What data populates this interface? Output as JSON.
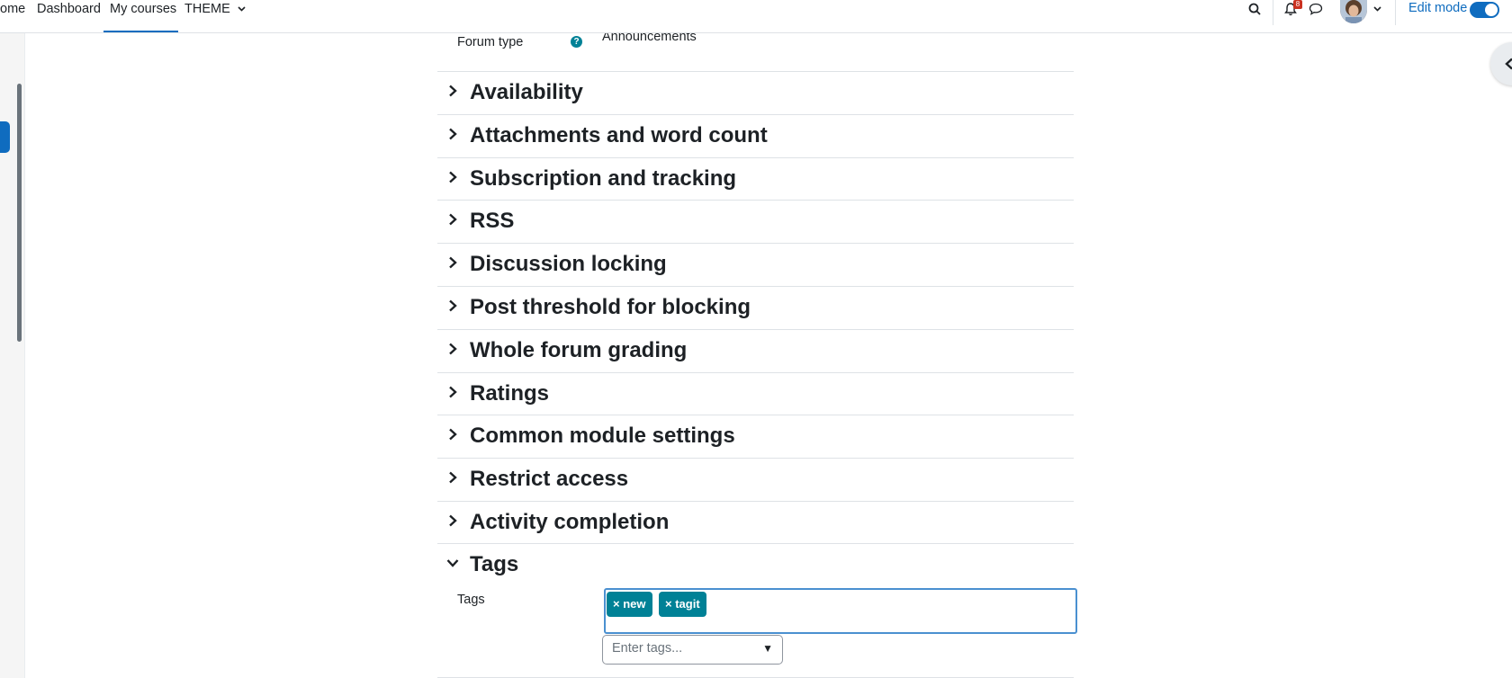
{
  "navbar": {
    "links": [
      "ome",
      "Dashboard",
      "My courses",
      "THEME"
    ],
    "notification_count": "8",
    "edit_mode_label": "Edit mode"
  },
  "form": {
    "forum_type_label": "Forum type",
    "forum_type_value": "Announcements",
    "sections": [
      "Availability",
      "Attachments and word count",
      "Subscription and tracking",
      "RSS",
      "Discussion locking",
      "Post threshold for blocking",
      "Whole forum grading",
      "Ratings",
      "Common module settings",
      "Restrict access",
      "Activity completion",
      "Tags"
    ],
    "tags_field_label": "Tags",
    "tags": [
      "× new",
      "× tagit"
    ],
    "tags_placeholder": "Enter tags...",
    "tags_dropdown_arrow": "▼"
  },
  "colors": {
    "accent": "#0f6cbf",
    "tag": "#008196",
    "badge": "#ca3120"
  }
}
